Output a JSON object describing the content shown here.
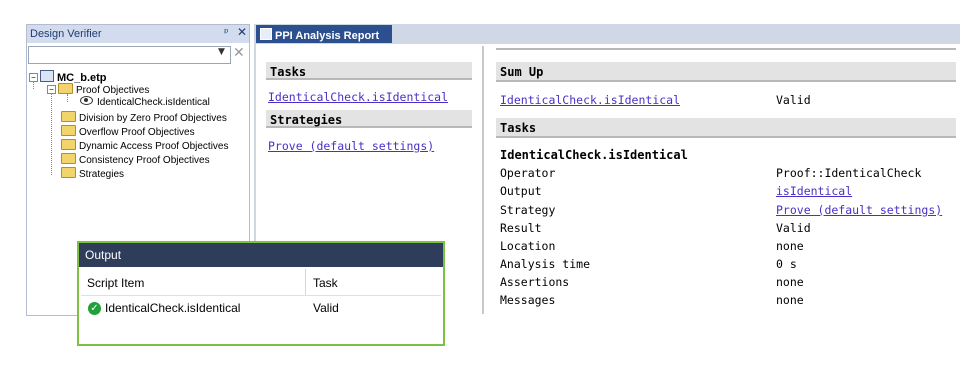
{
  "design_verifier": {
    "title": "Design Verifier",
    "pin": "ᵖ",
    "close": "✕",
    "tree": {
      "root": "MC_b.etp",
      "proof_objectives": "Proof Objectives",
      "identical_check": "IdenticalCheck.isIdentical",
      "division": "Division by Zero Proof Objectives",
      "overflow": "Overflow Proof Objectives",
      "dynamic": "Dynamic Access Proof Objectives",
      "consistency": "Consistency Proof Objectives",
      "strategies": "Strategies"
    }
  },
  "tab": {
    "label": "PPI Analysis Report",
    "close": "✕"
  },
  "left": {
    "tasks_header": "Tasks",
    "task_link": "IdenticalCheck.isIdentical",
    "strategies_header": "Strategies",
    "strategy_link": "Prove (default settings)"
  },
  "right": {
    "sumup_header": "Sum Up",
    "sumup_link": "IdenticalCheck.isIdentical",
    "sumup_status": "Valid",
    "tasks_header": "Tasks",
    "task_title": "IdenticalCheck.isIdentical",
    "rows": [
      {
        "key": "Operator",
        "value": "Proof::IdenticalCheck",
        "link": false
      },
      {
        "key": "Output",
        "value": "isIdentical",
        "link": true
      },
      {
        "key": "Strategy",
        "value": "Prove (default settings)",
        "link": true
      },
      {
        "key": "Result",
        "value": "Valid",
        "link": false
      },
      {
        "key": "Location",
        "value": "none",
        "link": false
      },
      {
        "key": "Analysis time",
        "value": "0 s",
        "link": false
      },
      {
        "key": "Assertions",
        "value": "none",
        "link": false
      },
      {
        "key": "Messages",
        "value": "none",
        "link": false
      }
    ]
  },
  "output": {
    "title": "Output",
    "col_script": "Script Item",
    "col_task": "Task",
    "row_item": "IdenticalCheck.isIdentical",
    "row_task": "Valid"
  }
}
